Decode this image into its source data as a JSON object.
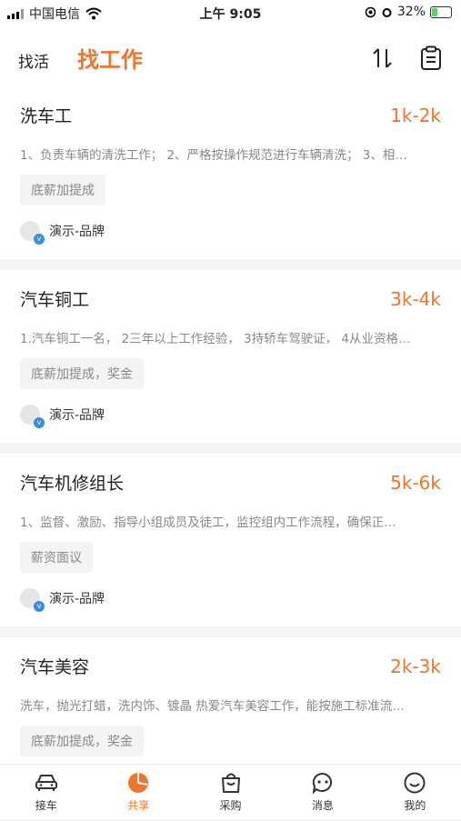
{
  "status": {
    "carrier": "中国电信",
    "time": "上午 9:05",
    "battery": "32%"
  },
  "header": {
    "tab_find_job": "找活",
    "tab_find_worker": "找工作"
  },
  "jobs": [
    {
      "title": "洗车工",
      "salary": "1k-2k",
      "desc": "1、负责车辆的清洗工作； 2、严格按操作规范进行车辆清洗； 3、相…",
      "tag": "底薪加提成",
      "brand": "演示-品牌"
    },
    {
      "title": "汽车铜工",
      "salary": "3k-4k",
      "desc": "1.汽车铜工一名， 2三年以上工作经验， 3持轿车驾驶证， 4从业资格…",
      "tag": "底薪加提成，奖金",
      "brand": "演示-品牌"
    },
    {
      "title": "汽车机修组长",
      "salary": "5k-6k",
      "desc": "1、监督、激励、指导小组成员及徒工，监控组内工作流程，确保正…",
      "tag": "薪资面议",
      "brand": "演示-品牌"
    },
    {
      "title": "汽车美容",
      "salary": "2k-3k",
      "desc": "洗车，抛光打蜡，洗内饰、镀晶 热爱汽车美容工作，能按施工标准流…",
      "tag": "底薪加提成，奖金",
      "brand": "演示-品牌"
    }
  ],
  "tabbar": [
    {
      "label": "接车",
      "icon": "car-icon"
    },
    {
      "label": "共享",
      "icon": "pie-chart-icon"
    },
    {
      "label": "采购",
      "icon": "shopping-bag-icon"
    },
    {
      "label": "消息",
      "icon": "chat-icon"
    },
    {
      "label": "我的",
      "icon": "smiley-icon"
    }
  ],
  "accent_color": "#f0742c"
}
